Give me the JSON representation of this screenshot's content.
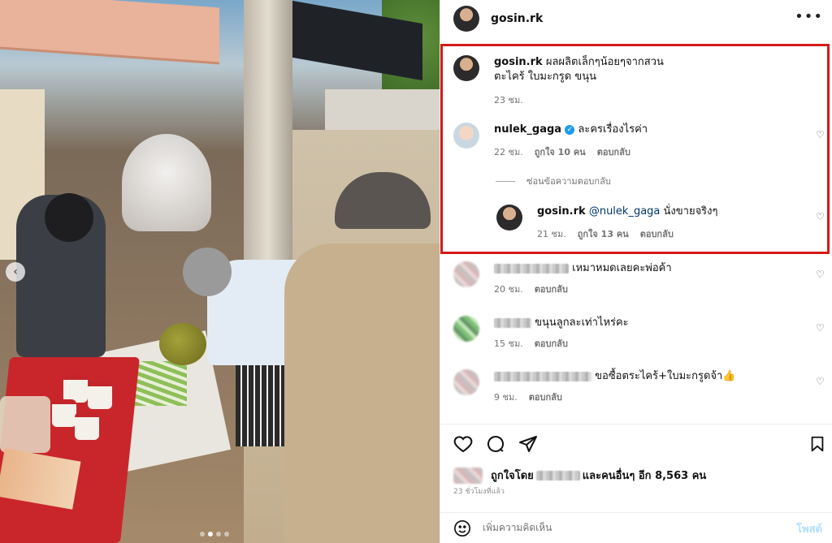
{
  "header": {
    "username": "gosin.rk",
    "more_icon": "more-horizontal-icon"
  },
  "photo": {
    "carousel_prev_icon": "chevron-left-icon",
    "dot_count": 4,
    "active_dot": 1
  },
  "caption": {
    "username": "gosin.rk",
    "text_line1": "ผลผลิตเล็กๆน้อยๆจากสวน",
    "text_line2": "ตะไคร้ ใบมะกรูด ขนุน",
    "time": "23 ชม."
  },
  "comments": [
    {
      "username": "nulek_gaga",
      "verified": true,
      "text": "ละครเรื่องไรค่า",
      "time": "22 ชม.",
      "likes": "ถูกใจ 10 คน",
      "reply_label": "ตอบกลับ"
    }
  ],
  "hide_replies_label": "ซ่อนข้อความตอบกลับ",
  "reply": {
    "username": "gosin.rk",
    "mention": "@nulek_gaga",
    "text": "นั่งขายจริงๆ",
    "time": "21 ชม.",
    "likes": "ถูกใจ 13 คน",
    "reply_label": "ตอบกลับ"
  },
  "other_comments": [
    {
      "text": "เหมาหมดเลยคะพ่อค้า",
      "time": "20 ชม.",
      "reply_label": "ตอบกลับ"
    },
    {
      "text": "ขนุนลูกละเท่าไหร่คะ",
      "time": "15 ชม.",
      "reply_label": "ตอบกลับ"
    },
    {
      "text": "ขอซื้อตระไคร้+ใบมะกรูดจ้า👍",
      "time": "9 ชม.",
      "reply_label": "ตอบกลับ"
    }
  ],
  "actions": {
    "like_icon": "heart-icon",
    "comment_icon": "comment-icon",
    "share_icon": "send-icon",
    "save_icon": "bookmark-icon"
  },
  "likes_summary": {
    "prefix": "ถูกใจโดย",
    "suffix": "และคนอื่นๆ อีก 8,563 คน"
  },
  "posted_ago": "23 ชั่วโมงที่แล้ว",
  "composer": {
    "emoji_icon": "smiley-icon",
    "placeholder": "เพิ่มความคิดเห็น",
    "post_label": "โพสต์"
  },
  "colors": {
    "highlight_border": "#d31a1a",
    "verified_badge": "#1d9bf0",
    "post_button_disabled": "#b2dffc",
    "mention": "#00376b"
  }
}
